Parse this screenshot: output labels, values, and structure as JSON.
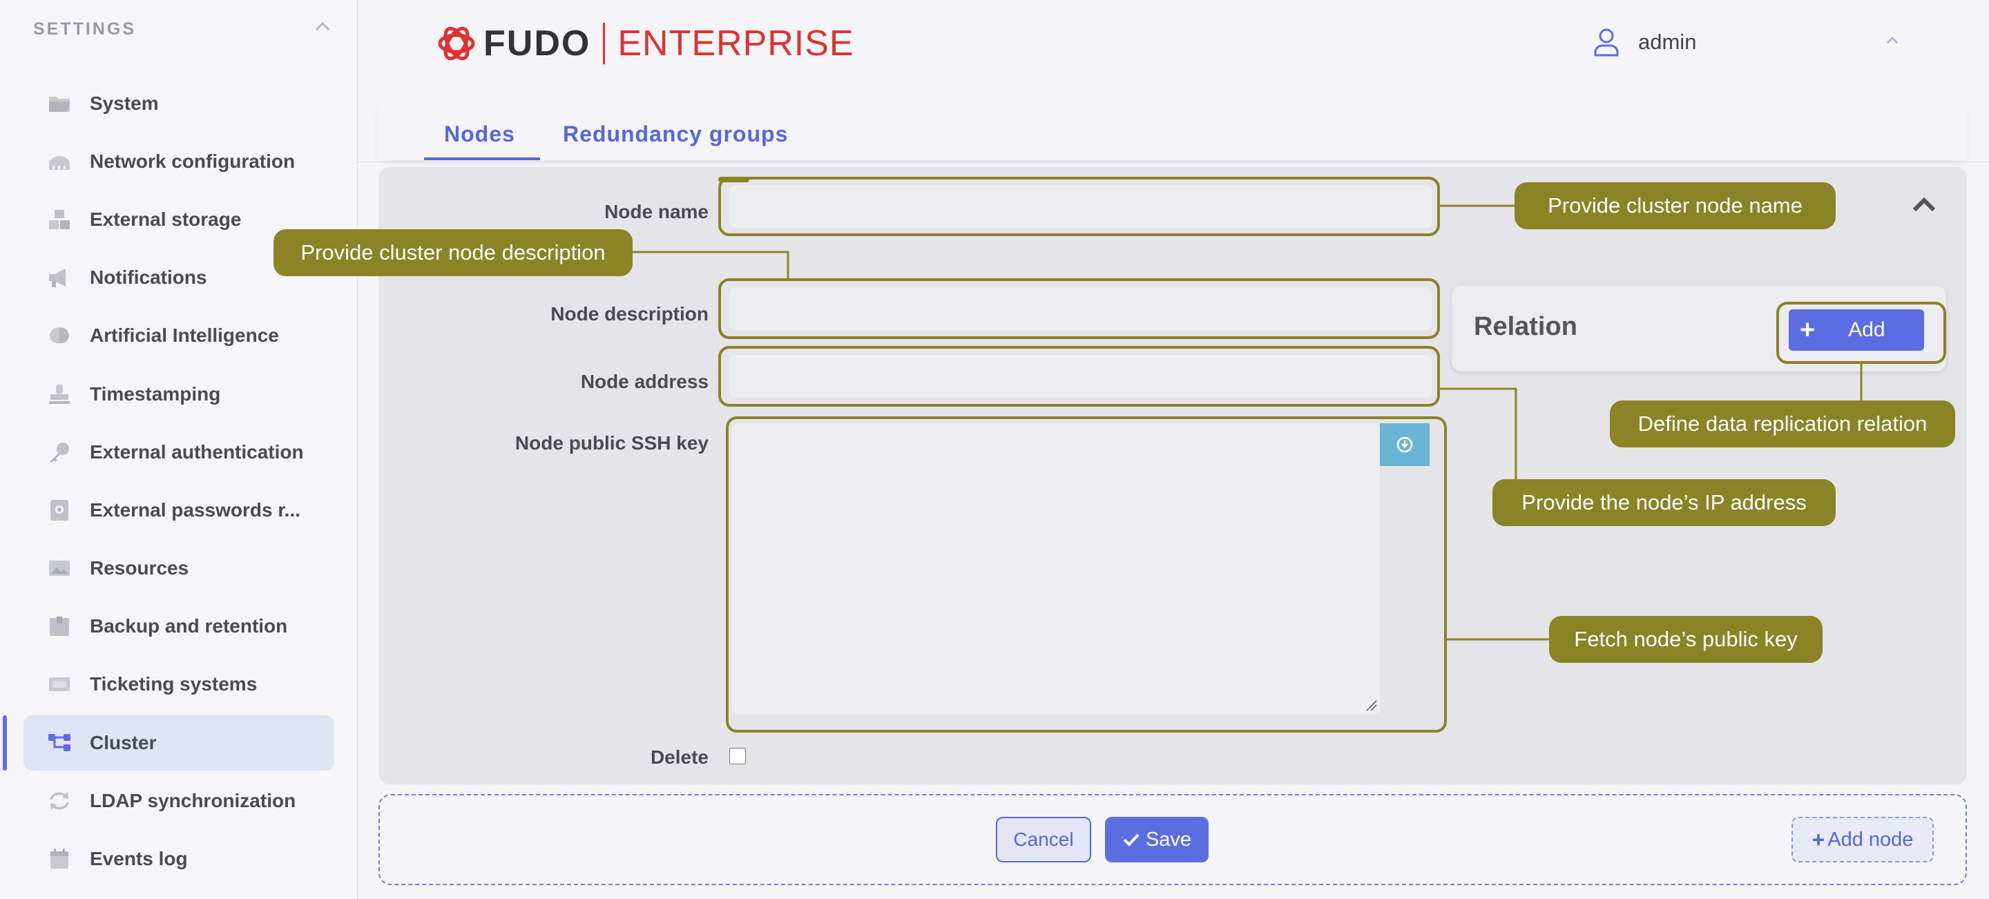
{
  "sidebar": {
    "heading": "SETTINGS",
    "items": [
      {
        "label": "System",
        "icon": "folder-icon"
      },
      {
        "label": "Network configuration",
        "icon": "network-icon"
      },
      {
        "label": "External storage",
        "icon": "boxes-icon"
      },
      {
        "label": "Notifications",
        "icon": "megaphone-icon"
      },
      {
        "label": "Artificial Intelligence",
        "icon": "brain-icon"
      },
      {
        "label": "Timestamping",
        "icon": "stamp-icon"
      },
      {
        "label": "External authentication",
        "icon": "key-icon"
      },
      {
        "label": "External passwords r...",
        "icon": "vault-icon"
      },
      {
        "label": "Resources",
        "icon": "image-icon"
      },
      {
        "label": "Backup and retention",
        "icon": "archive-icon"
      },
      {
        "label": "Ticketing systems",
        "icon": "ticket-icon"
      },
      {
        "label": "Cluster",
        "icon": "cluster-icon",
        "active": true
      },
      {
        "label": "LDAP synchronization",
        "icon": "sync-icon"
      },
      {
        "label": "Events log",
        "icon": "calendar-icon"
      }
    ]
  },
  "header": {
    "logo_fudo": "FUDO",
    "logo_enterprise": "ENTERPRISE",
    "user": "admin"
  },
  "tabs": [
    {
      "label": "Nodes",
      "active": true
    },
    {
      "label": "Redundancy groups",
      "active": false
    }
  ],
  "form": {
    "node_name_label": "Node name",
    "node_name_value": "",
    "node_description_label": "Node description",
    "node_description_value": "",
    "node_address_label": "Node address",
    "node_address_value": "",
    "node_ssh_key_label": "Node public SSH key",
    "node_ssh_key_value": "",
    "delete_label": "Delete",
    "delete_checked": false
  },
  "relation": {
    "title": "Relation",
    "add_label": "Add"
  },
  "callouts": {
    "node_name": "Provide cluster node name",
    "node_description": "Provide cluster node description",
    "relation": "Define data replication relation",
    "address": "Provide the node’s IP address",
    "public_key": "Fetch node’s public key"
  },
  "actions": {
    "cancel": "Cancel",
    "save": "Save",
    "add_node": "Add node"
  },
  "colors": {
    "accent": "#5b6ee1",
    "brand_red": "#dd3333",
    "callout": "#8a8426",
    "fetch_button": "#6ab4d4"
  }
}
